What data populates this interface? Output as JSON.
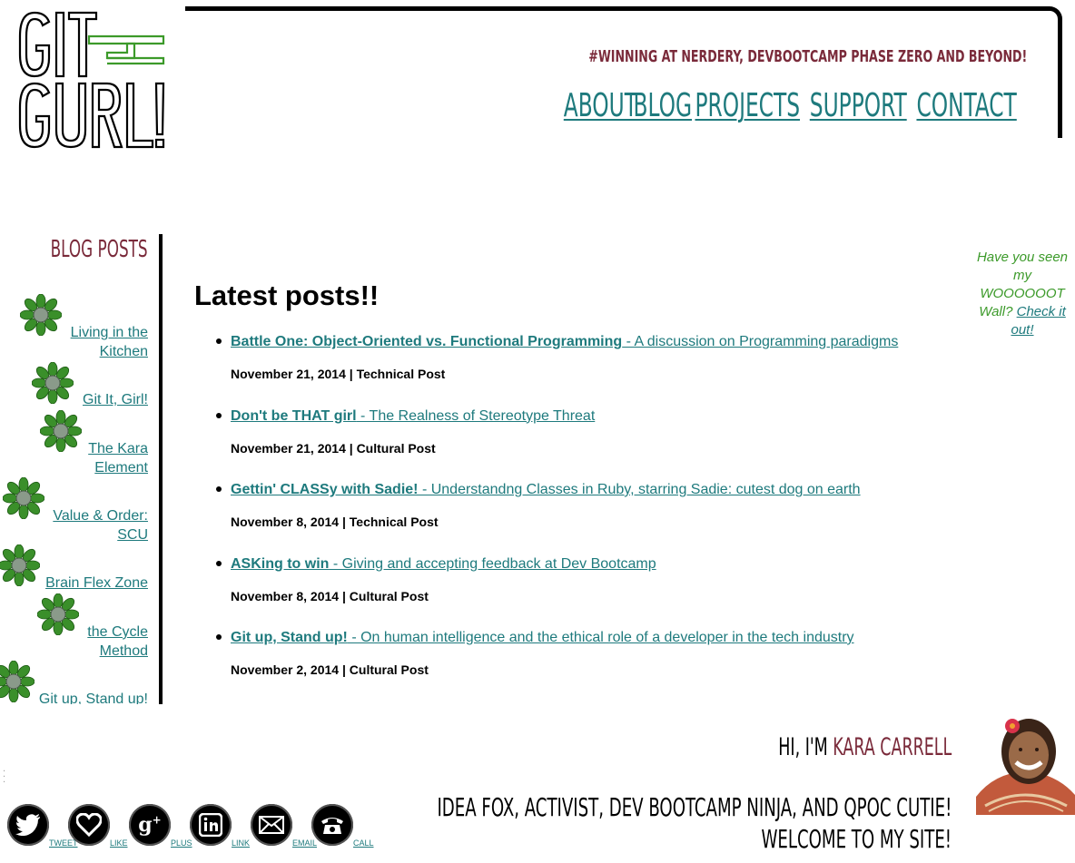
{
  "logo": {
    "line1": "GIT",
    "line2": "GURL!"
  },
  "header": {
    "tagline": "#WINNING AT NERDERY, DEVBOOTCAMP PHASE ZERO AND BEYOND!",
    "nav": [
      "ABOUT",
      "BLOG",
      "PROJECTS",
      "SUPPORT",
      "CONTACT"
    ]
  },
  "sidebar": {
    "title": "BLOG POSTS",
    "items": [
      {
        "label": "Living in the Kitchen"
      },
      {
        "label": "Git It, Girl!"
      },
      {
        "label": "The Kara Element"
      },
      {
        "label": "Value & Order: SCU"
      },
      {
        "label": "Brain Flex Zone"
      },
      {
        "label": "the Cycle Method"
      },
      {
        "label": "Git up, Stand up!"
      }
    ]
  },
  "main": {
    "title": "Latest posts!!",
    "posts": [
      {
        "title": "Battle One: Object-Oriented vs. Functional Programming",
        "desc": " - A discussion on Programming paradigms",
        "date": "November 21, 2014",
        "category": "Technical Post"
      },
      {
        "title": "Don't be THAT girl",
        "desc": " - The Realness of Stereotype Threat",
        "date": "November 21, 2014",
        "category": "Cultural Post"
      },
      {
        "title": "Gettin' CLASSy with Sadie!",
        "desc": " - Understandng Classes in Ruby, starring Sadie: cutest dog on earth",
        "date": "November 8, 2014",
        "category": "Technical Post"
      },
      {
        "title": "ASKing to win",
        "desc": " - Giving and accepting feedback at Dev Bootcamp",
        "date": "November 8, 2014",
        "category": "Cultural Post"
      },
      {
        "title": "Git up, Stand up!",
        "desc": " - On human intelligence and the ethical role of a developer in the tech industry",
        "date": "November 2, 2014",
        "category": "Cultural Post"
      }
    ]
  },
  "wall_note": {
    "text": "Have you seen my WOOOOOOT Wall?",
    "link": "Check it out!"
  },
  "bio": {
    "greeting": "HI, I'M ",
    "name": "KARA CARRELL",
    "line1": "IDEA FOX, ACTIVIST, DEV BOOTCAMP NINJA, AND QPOC CUTIE!",
    "line2": "WELCOME TO MY SITE!"
  },
  "social": [
    {
      "icon": "twitter-icon",
      "label": "TWEET"
    },
    {
      "icon": "heart-icon",
      "label": "LIKE"
    },
    {
      "icon": "google-plus-icon",
      "label": "PLUS"
    },
    {
      "icon": "linkedin-icon",
      "label": "LINK"
    },
    {
      "icon": "email-icon",
      "label": "EMAIL"
    },
    {
      "icon": "phone-icon",
      "label": "CALL"
    }
  ],
  "colors": {
    "teal": "#1e7a7d",
    "maroon": "#7a2a3a",
    "green": "#3c9a2a"
  }
}
